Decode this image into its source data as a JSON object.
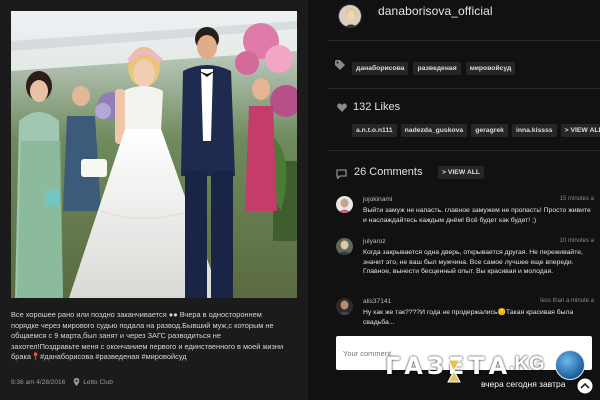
{
  "post": {
    "caption_lines": [
      "Все хорошее рано или поздно заканчивается ●● Вчера в одностороннем",
      "порядке через мирового судью подала на развод.Бывший муж,с которым не",
      "общаемся с 9 марта,был занят и через ЗАГС разводиться не",
      "захотел!Поздравьте меня с окончанием первого и единственного в моей жизни",
      "брака📍#данаборисова #разведеная #мировойсуд"
    ],
    "timestamp": "9:36 am 4/28/2016",
    "location": "Letto Club"
  },
  "profile": {
    "username": "danaborisova_official"
  },
  "tags": [
    "данаборисова",
    "разведеная",
    "мировойсуд"
  ],
  "likes": {
    "count_label": "132 Likes",
    "users": [
      "a.n.t.o.n111",
      "nadezda_guskova",
      "geragrek",
      "inna.kissss"
    ],
    "view_all": "> VIEW ALL"
  },
  "comments_section": {
    "count_label": "26 Comments",
    "view_all": "> VIEW ALL",
    "items": [
      {
        "user": "jojokinami",
        "time": "15 minutes a",
        "text": "Выйти замуж не напасть. главное замужем не пропасть! Просто живите и наслаждайтесь каждым днём! Всё будет как будет! ;)"
      },
      {
        "user": "julyaroz",
        "time": "10 minutes a",
        "text": "Когда закрывается одна дверь, открывается другая. Не переживайте, значит это, не ваш был мужчина. Все самое лучшее еще впереди. Главное, вынести бесценный опыт. Вы красивая и молодая."
      },
      {
        "user": "alis37141",
        "time": "less than a minute a",
        "text": "Ну как же так????И года не продержались😔Такая красивая была свадьба..."
      }
    ]
  },
  "comment_input": {
    "placeholder": "Your comment"
  },
  "watermark": {
    "title": "ГАЗЕТА",
    "kg": ".KG",
    "tagline": "вчера сегодня завтра"
  },
  "colors": {
    "background": "#000000",
    "panel": "#1b1b1b",
    "chip": "#262626",
    "accent_globe": "#1c5e9c"
  }
}
